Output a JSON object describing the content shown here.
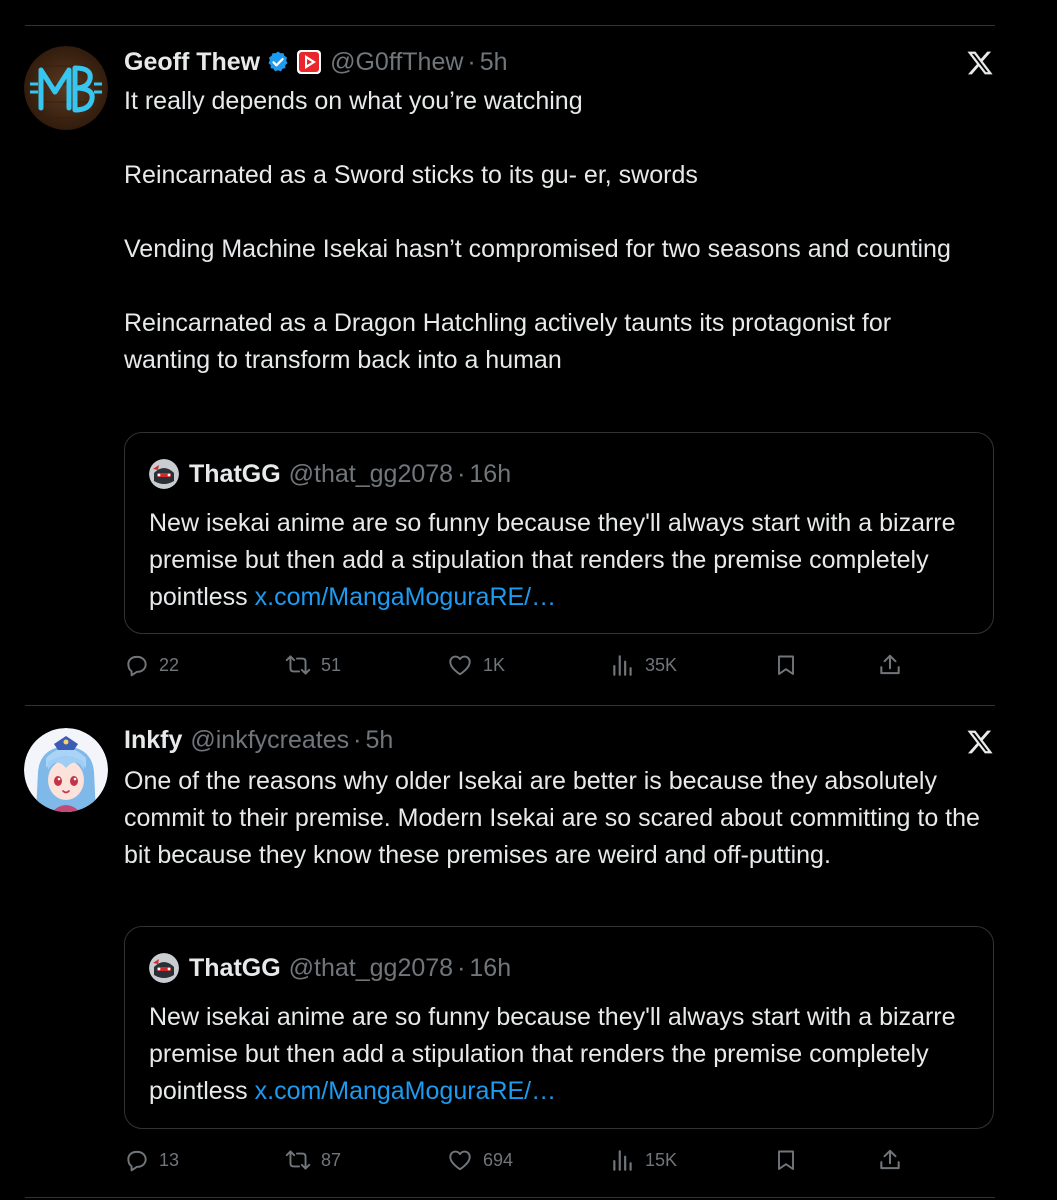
{
  "tweets": [
    {
      "author_name": "Geoff Thew",
      "handle": "@G0ffThew",
      "separator": "·",
      "time": "5h",
      "avatar_icon": "mb-logo-avatar",
      "verified": true,
      "paragraphs": [
        "It really depends on what you’re watching",
        "Reincarnated as a Sword sticks to its gu- er, swords",
        "Vending Machine Isekai hasn’t compromised for two seasons and counting",
        "Reincarnated as a Dragon Hatchling actively taunts its protagonist for wanting to transform back into a human"
      ],
      "quote": {
        "author_name": "ThatGG",
        "handle": "@that_gg2078",
        "separator": "·",
        "time": "16h",
        "text": "New isekai anime are so funny because they'll always start with a bizarre premise but then add a stipulation that renders the premise completely pointless",
        "link": "x.com/MangaMoguraRE/…"
      },
      "stats": {
        "replies": "22",
        "reposts": "51",
        "likes": "1K",
        "views": "35K"
      }
    },
    {
      "author_name": "Inkfy",
      "handle": "@inkfycreates",
      "separator": "·",
      "time": "5h",
      "avatar_icon": "anime-girl-avatar",
      "verified": false,
      "paragraphs": [
        "One of the reasons why older Isekai are better is because they absolutely commit to their premise. Modern Isekai are so scared about committing to the bit because they know these premises are weird and off-putting."
      ],
      "quote": {
        "author_name": "ThatGG",
        "handle": "@that_gg2078",
        "separator": "·",
        "time": "16h",
        "text": "New isekai anime are so funny because they'll always start with a bizarre premise but then add a stipulation that renders the premise completely pointless",
        "link": "x.com/MangaMoguraRE/…"
      },
      "stats": {
        "replies": "13",
        "reposts": "87",
        "likes": "694",
        "views": "15K"
      }
    }
  ],
  "colors": {
    "background": "#000000",
    "text": "#e7e9ea",
    "muted": "#71767b",
    "link": "#1d9bf0",
    "verified": "#1d9bf0",
    "divider": "#2f3336"
  },
  "icons": [
    "verified-badge-icon",
    "affiliate-badge-icon",
    "x-logo-icon",
    "reply-icon",
    "repost-icon",
    "like-icon",
    "views-icon",
    "bookmark-icon",
    "share-icon"
  ]
}
